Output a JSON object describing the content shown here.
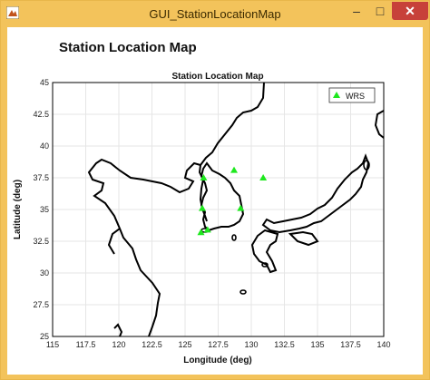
{
  "window": {
    "title": "GUI_StationLocationMap",
    "minimize_glyph": "–",
    "maximize_glyph": "□",
    "close_glyph": "✕",
    "accent_color": "#f3c35b",
    "close_color": "#c7413a"
  },
  "figure": {
    "heading": "Station Location Map"
  },
  "chart_data": {
    "type": "scatter",
    "title": "Station Location Map",
    "xlabel": "Longitude (deg)",
    "ylabel": "Latitude (deg)",
    "xlim": [
      115,
      140
    ],
    "ylim": [
      25,
      45
    ],
    "xticks": [
      "115",
      "117.5",
      "120",
      "122.5",
      "125",
      "127.5",
      "130",
      "132.5",
      "135",
      "137.5",
      "140"
    ],
    "yticks": [
      "25",
      "27.5",
      "30",
      "32.5",
      "35",
      "37.5",
      "40",
      "42.5",
      "45"
    ],
    "grid": true,
    "legend_position": "top-right",
    "marker": "triangle",
    "marker_color": "#1ee81e",
    "series": [
      {
        "name": "WRS",
        "points": [
          {
            "lon": 126.4,
            "lat": 37.5
          },
          {
            "lon": 128.7,
            "lat": 38.1
          },
          {
            "lon": 130.9,
            "lat": 37.5
          },
          {
            "lon": 126.3,
            "lat": 35.1
          },
          {
            "lon": 129.2,
            "lat": 35.1
          },
          {
            "lon": 126.7,
            "lat": 33.4
          },
          {
            "lon": 126.2,
            "lat": 33.2
          }
        ]
      }
    ]
  }
}
